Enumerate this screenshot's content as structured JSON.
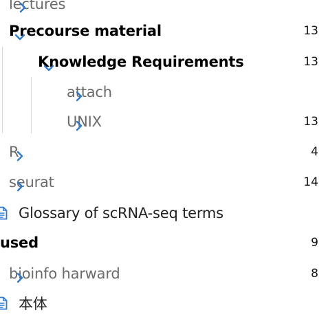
{
  "tree": {
    "items": [
      {
        "label": "lectures",
        "count": "",
        "chevron": "right",
        "style": "dim"
      },
      {
        "label": "Precourse material",
        "count": "13",
        "chevron": "down",
        "style": "bold"
      },
      {
        "label": "Knowledge Requirements",
        "count": "13",
        "chevron": "down",
        "style": "bold"
      },
      {
        "label": "attach",
        "count": "",
        "chevron": "right",
        "style": "dim"
      },
      {
        "label": "UNIX",
        "count": "13",
        "chevron": "right",
        "style": "dim"
      },
      {
        "label": "R",
        "count": "4",
        "chevron": "right",
        "style": "dim"
      },
      {
        "label": "seurat",
        "count": "14",
        "chevron": "right",
        "style": "dim"
      },
      {
        "label": "Glossary of scRNA-seq terms",
        "count": "",
        "chevron": "none",
        "style": "normal",
        "icon": "document-icon"
      },
      {
        "label": "used",
        "count": "9",
        "chevron": "none",
        "style": "bold"
      },
      {
        "label": "bioinfo harward",
        "count": "8",
        "chevron": "right",
        "style": "dim"
      },
      {
        "label": "本体",
        "count": "",
        "chevron": "none",
        "style": "normal",
        "icon": "document-icon"
      }
    ]
  },
  "colors": {
    "accent": "#2f79d6",
    "guide": "#d9d9d9",
    "dim_text": "#6b6b6b"
  }
}
